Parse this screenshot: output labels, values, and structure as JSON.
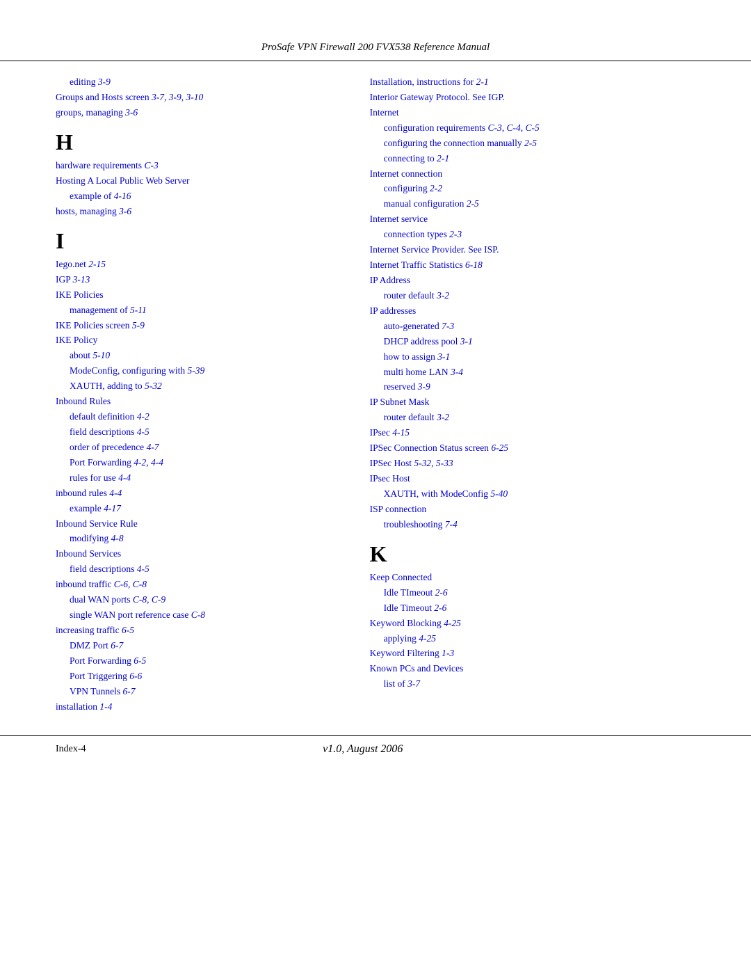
{
  "header": {
    "title": "ProSafe VPN Firewall 200 FVX538 Reference Manual"
  },
  "footer": {
    "index_label": "Index-4",
    "version": "v1.0, August 2006"
  },
  "left_column": {
    "entries_top": [
      {
        "text": "editing  3-9",
        "indent": 1,
        "link": true
      },
      {
        "text": "Groups and Hosts screen  3-7, 3-9, 3-10",
        "indent": 0,
        "link": true
      },
      {
        "text": "groups, managing  3-6",
        "indent": 0,
        "link": true
      }
    ],
    "section_H": "H",
    "entries_H": [
      {
        "text": "hardware requirements  C-3",
        "indent": 0,
        "link": true
      },
      {
        "text": "Hosting A Local Public Web Server",
        "indent": 0,
        "link": true
      },
      {
        "text": "example of  4-16",
        "indent": 1,
        "link": true
      },
      {
        "text": "hosts, managing  3-6",
        "indent": 0,
        "link": true
      }
    ],
    "section_I": "I",
    "entries_I": [
      {
        "text": "Iego.net  2-15",
        "indent": 0,
        "link": true
      },
      {
        "text": "IGP  3-13",
        "indent": 0,
        "link": true
      },
      {
        "text": "IKE Policies",
        "indent": 0,
        "link": true
      },
      {
        "text": "management of  5-11",
        "indent": 1,
        "link": true
      },
      {
        "text": "IKE Policies screen  5-9",
        "indent": 0,
        "link": true
      },
      {
        "text": "IKE Policy",
        "indent": 0,
        "link": true
      },
      {
        "text": "about  5-10",
        "indent": 1,
        "link": true
      },
      {
        "text": "ModeConfig, configuring with  5-39",
        "indent": 1,
        "link": true
      },
      {
        "text": "XAUTH, adding to  5-32",
        "indent": 1,
        "link": true
      },
      {
        "text": "Inbound Rules",
        "indent": 0,
        "link": true
      },
      {
        "text": "default definition  4-2",
        "indent": 1,
        "link": true
      },
      {
        "text": "field descriptions  4-5",
        "indent": 1,
        "link": true
      },
      {
        "text": "order of precedence  4-7",
        "indent": 1,
        "link": true
      },
      {
        "text": "Port Forwarding  4-2, 4-4",
        "indent": 1,
        "link": true
      },
      {
        "text": "rules for use  4-4",
        "indent": 1,
        "link": true
      },
      {
        "text": "inbound rules  4-4",
        "indent": 0,
        "link": true
      },
      {
        "text": "example  4-17",
        "indent": 1,
        "link": true
      },
      {
        "text": "Inbound Service Rule",
        "indent": 0,
        "link": true
      },
      {
        "text": "modifying  4-8",
        "indent": 1,
        "link": true
      },
      {
        "text": "Inbound Services",
        "indent": 0,
        "link": true
      },
      {
        "text": "field descriptions  4-5",
        "indent": 1,
        "link": true
      },
      {
        "text": "inbound traffic  C-6, C-8",
        "indent": 0,
        "link": true
      },
      {
        "text": "dual WAN ports  C-8, C-9",
        "indent": 1,
        "link": true
      },
      {
        "text": "single WAN port reference case  C-8",
        "indent": 1,
        "link": true
      },
      {
        "text": "increasing traffic  6-5",
        "indent": 0,
        "link": true
      },
      {
        "text": "DMZ Port  6-7",
        "indent": 1,
        "link": true
      },
      {
        "text": "Port Forwarding  6-5",
        "indent": 1,
        "link": true
      },
      {
        "text": "Port Triggering  6-6",
        "indent": 1,
        "link": true
      },
      {
        "text": "VPN Tunnels  6-7",
        "indent": 1,
        "link": true
      },
      {
        "text": "installation  1-4",
        "indent": 0,
        "link": true
      }
    ]
  },
  "right_column": {
    "entries_top": [
      {
        "text": "Installation, instructions for  2-1",
        "indent": 0,
        "link": true
      },
      {
        "text": "Interior Gateway Protocol. See IGP.",
        "indent": 0,
        "link": true
      },
      {
        "text": "Internet",
        "indent": 0,
        "link": true
      },
      {
        "text": "configuration requirements  C-3, C-4, C-5",
        "indent": 1,
        "link": true
      },
      {
        "text": "configuring the connection manually  2-5",
        "indent": 1,
        "link": true
      },
      {
        "text": "connecting to  2-1",
        "indent": 1,
        "link": true
      },
      {
        "text": "Internet connection",
        "indent": 0,
        "link": true
      },
      {
        "text": "configuring  2-2",
        "indent": 1,
        "link": true
      },
      {
        "text": "manual configuration  2-5",
        "indent": 1,
        "link": true
      },
      {
        "text": "Internet service",
        "indent": 0,
        "link": true
      },
      {
        "text": "connection types  2-3",
        "indent": 1,
        "link": true
      },
      {
        "text": "Internet Service Provider. See ISP.",
        "indent": 0,
        "link": true
      },
      {
        "text": "Internet Traffic Statistics  6-18",
        "indent": 0,
        "link": true
      },
      {
        "text": "IP Address",
        "indent": 0,
        "link": true
      },
      {
        "text": "router default  3-2",
        "indent": 1,
        "link": true
      },
      {
        "text": "IP addresses",
        "indent": 0,
        "link": true
      },
      {
        "text": "auto-generated  7-3",
        "indent": 1,
        "link": true
      },
      {
        "text": "DHCP address pool  3-1",
        "indent": 1,
        "link": true
      },
      {
        "text": "how to assign  3-1",
        "indent": 1,
        "link": true
      },
      {
        "text": "multi home LAN  3-4",
        "indent": 1,
        "link": true
      },
      {
        "text": "reserved  3-9",
        "indent": 1,
        "link": true
      },
      {
        "text": "IP Subnet Mask",
        "indent": 0,
        "link": true
      },
      {
        "text": "router default  3-2",
        "indent": 1,
        "link": true
      },
      {
        "text": "IPsec  4-15",
        "indent": 0,
        "link": true
      },
      {
        "text": "IPSec Connection Status screen  6-25",
        "indent": 0,
        "link": true
      },
      {
        "text": "IPSec Host  5-32, 5-33",
        "indent": 0,
        "link": true
      },
      {
        "text": "IPsec Host",
        "indent": 0,
        "link": true
      },
      {
        "text": "XAUTH, with ModeConfig  5-40",
        "indent": 1,
        "link": true
      },
      {
        "text": "ISP connection",
        "indent": 0,
        "link": true
      },
      {
        "text": "troubleshooting  7-4",
        "indent": 1,
        "link": true
      }
    ],
    "section_K": "K",
    "entries_K": [
      {
        "text": "Keep Connected",
        "indent": 0,
        "link": true
      },
      {
        "text": "Idle TImeout  2-6",
        "indent": 1,
        "link": true
      },
      {
        "text": "Idle Timeout  2-6",
        "indent": 1,
        "link": true
      },
      {
        "text": "Keyword Blocking  4-25",
        "indent": 0,
        "link": true
      },
      {
        "text": "applying  4-25",
        "indent": 1,
        "link": true
      },
      {
        "text": "Keyword Filtering  1-3",
        "indent": 0,
        "link": true
      },
      {
        "text": "Known PCs and Devices",
        "indent": 0,
        "link": true
      },
      {
        "text": "list of  3-7",
        "indent": 1,
        "link": true
      }
    ]
  }
}
